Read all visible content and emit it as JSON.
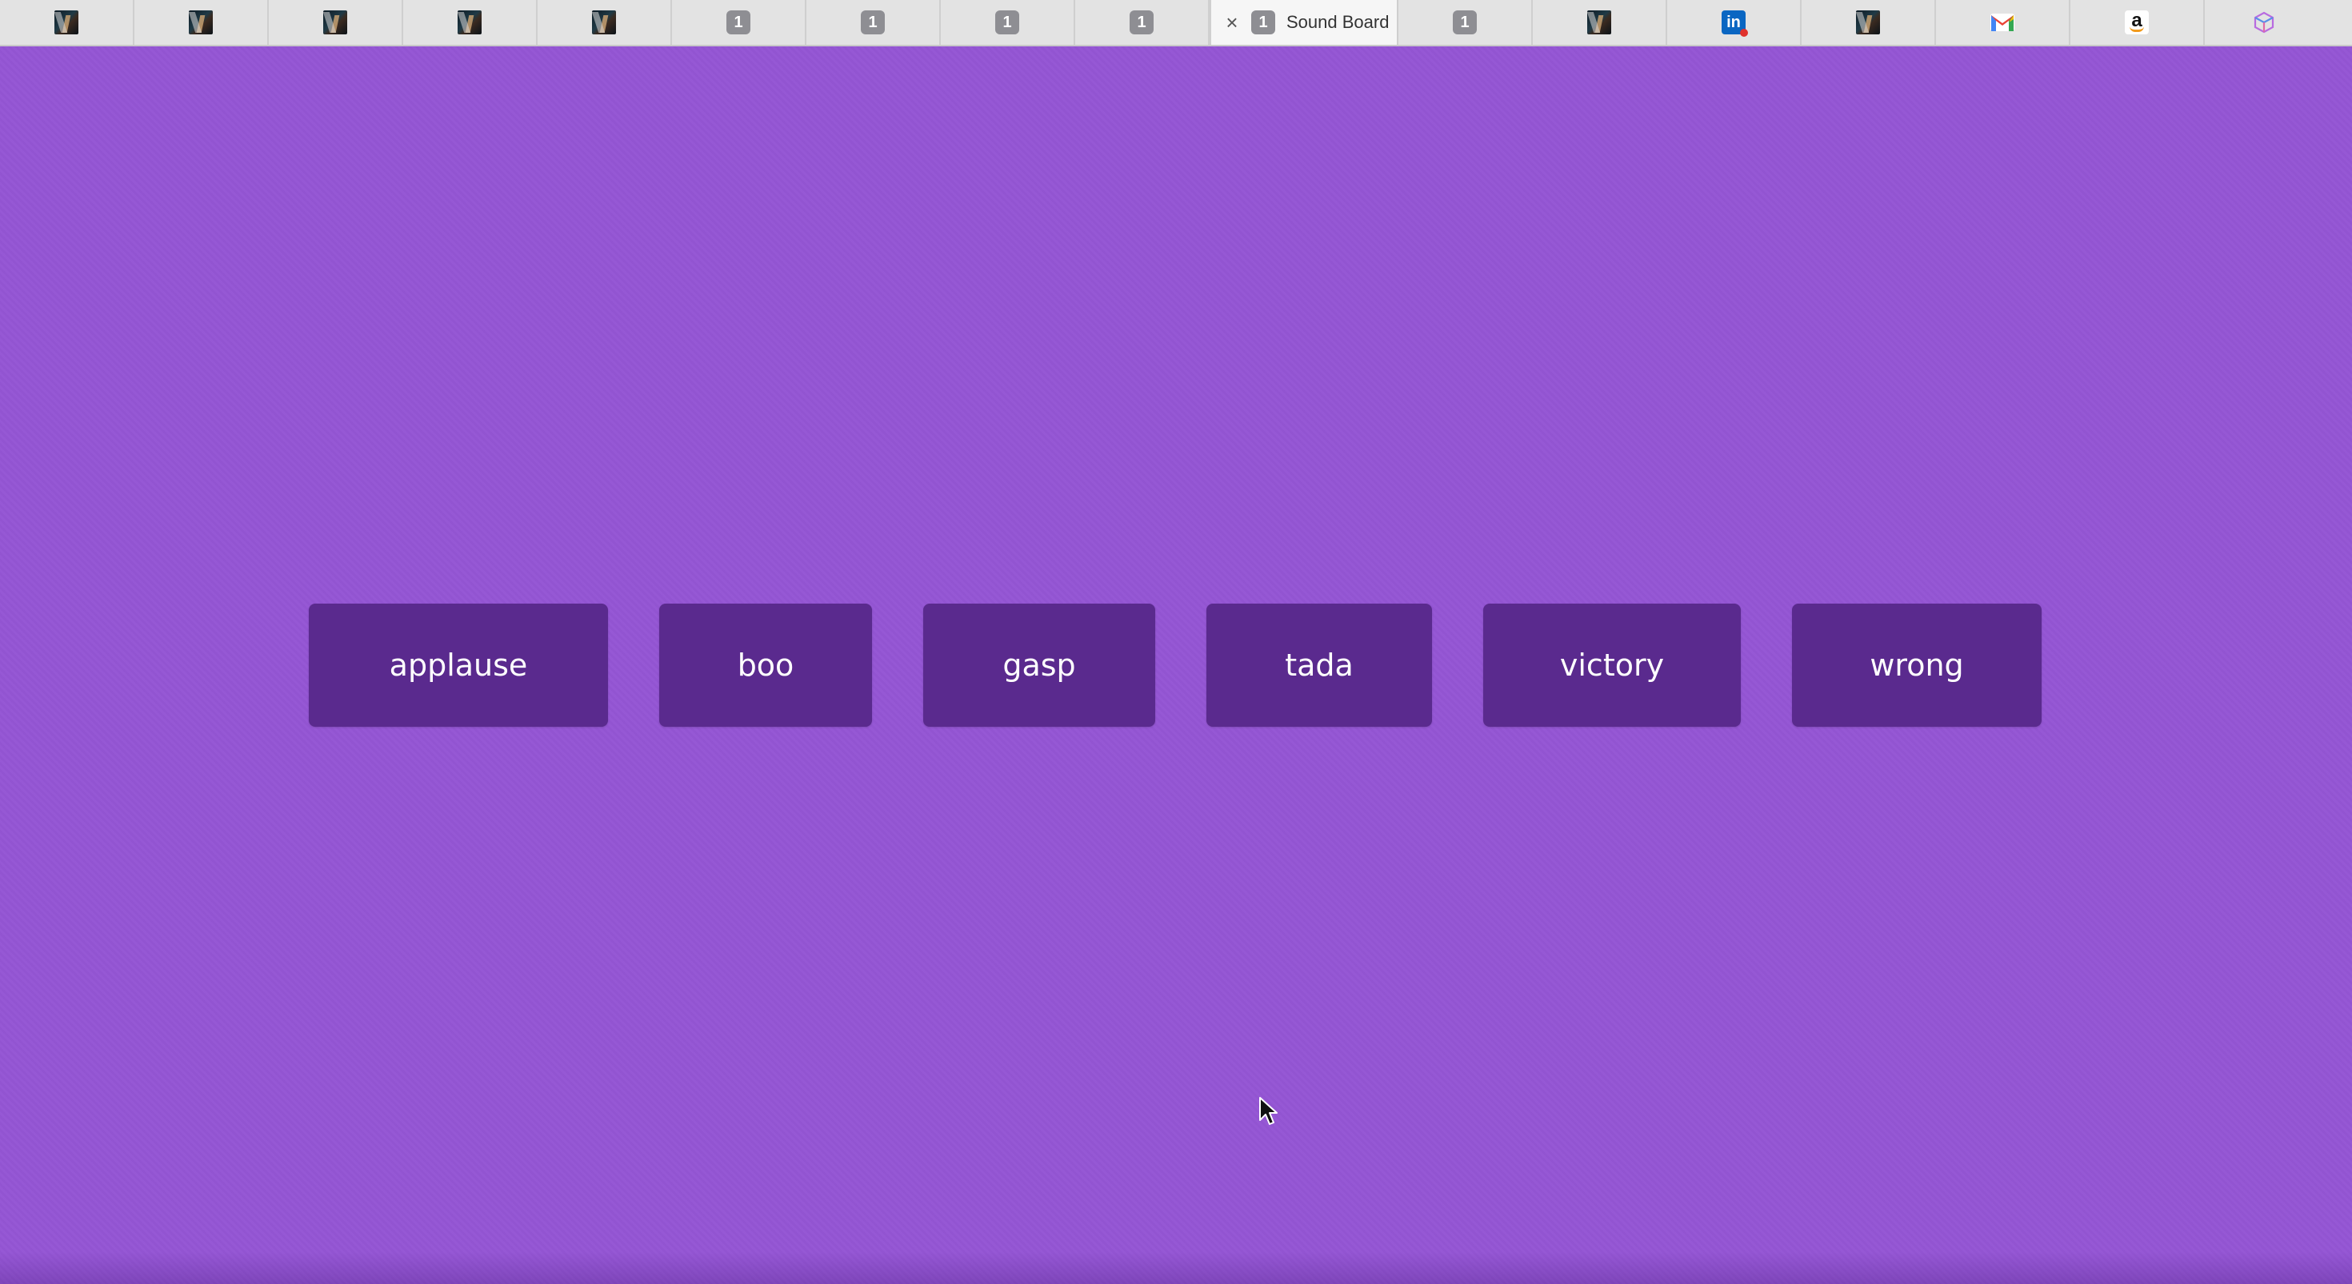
{
  "tabs": {
    "active_title": "Sound Board",
    "badge": "1",
    "linkedin_glyph": "in",
    "amazon_glyph": "a",
    "icons": [
      "photo",
      "photo",
      "photo",
      "photo",
      "photo",
      "num-badge",
      "num-badge",
      "num-badge",
      "num-badge",
      "num-badge",
      "num-badge",
      "photo",
      "linkedin",
      "photo",
      "gmail",
      "amazon",
      "cube"
    ]
  },
  "soundboard": {
    "background_color": "#9455d4",
    "button_color": "#5a2a8e",
    "buttons": [
      "applause",
      "boo",
      "gasp",
      "tada",
      "victory",
      "wrong"
    ]
  }
}
